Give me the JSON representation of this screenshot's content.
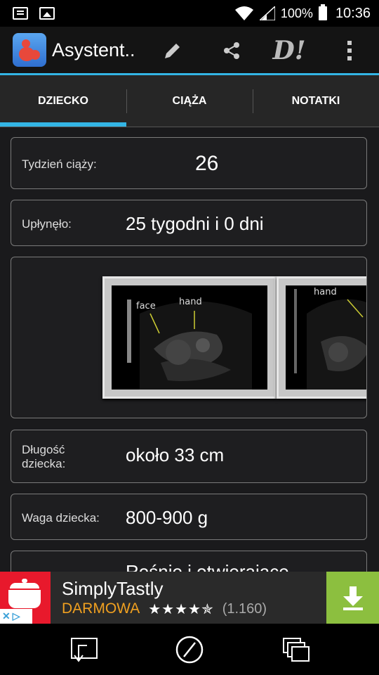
{
  "status_bar": {
    "battery_text": "100%",
    "time": "10:36"
  },
  "app_bar": {
    "title": "Asystent..",
    "actions": [
      "edit-icon",
      "share-icon",
      "di-logo",
      "more-icon"
    ],
    "logo_text": "D!"
  },
  "tabs": [
    {
      "label": "DZIECKO",
      "active": true
    },
    {
      "label": "CIĄŻA",
      "active": false
    },
    {
      "label": "NOTATKI",
      "active": false
    }
  ],
  "fields": {
    "week_label": "Tydzień ciąży:",
    "week_value": "26",
    "elapsed_label": "Upłynęło:",
    "elapsed_value": "25 tygodni i 0 dni",
    "length_label": "Długość dziecka:",
    "length_value": "około 33 cm",
    "weight_label": "Waga dziecka:",
    "weight_value": "800-900 g",
    "next_value": "Rośnie i otwierające"
  },
  "ultrasound": {
    "image1_labels": [
      "face",
      "hand"
    ],
    "image2_labels": [
      "hand"
    ]
  },
  "ad": {
    "app_name": "SimplyTastly",
    "price": "DARMOWA",
    "stars": "★★★★✯",
    "rating_count": "(1.160)",
    "rating_stars": 4.5
  },
  "colors": {
    "accent": "#33b5e5",
    "ad_price": "#f0a020",
    "ad_download": "#8cbf3f",
    "ad_icon_bg": "#e8192c"
  }
}
